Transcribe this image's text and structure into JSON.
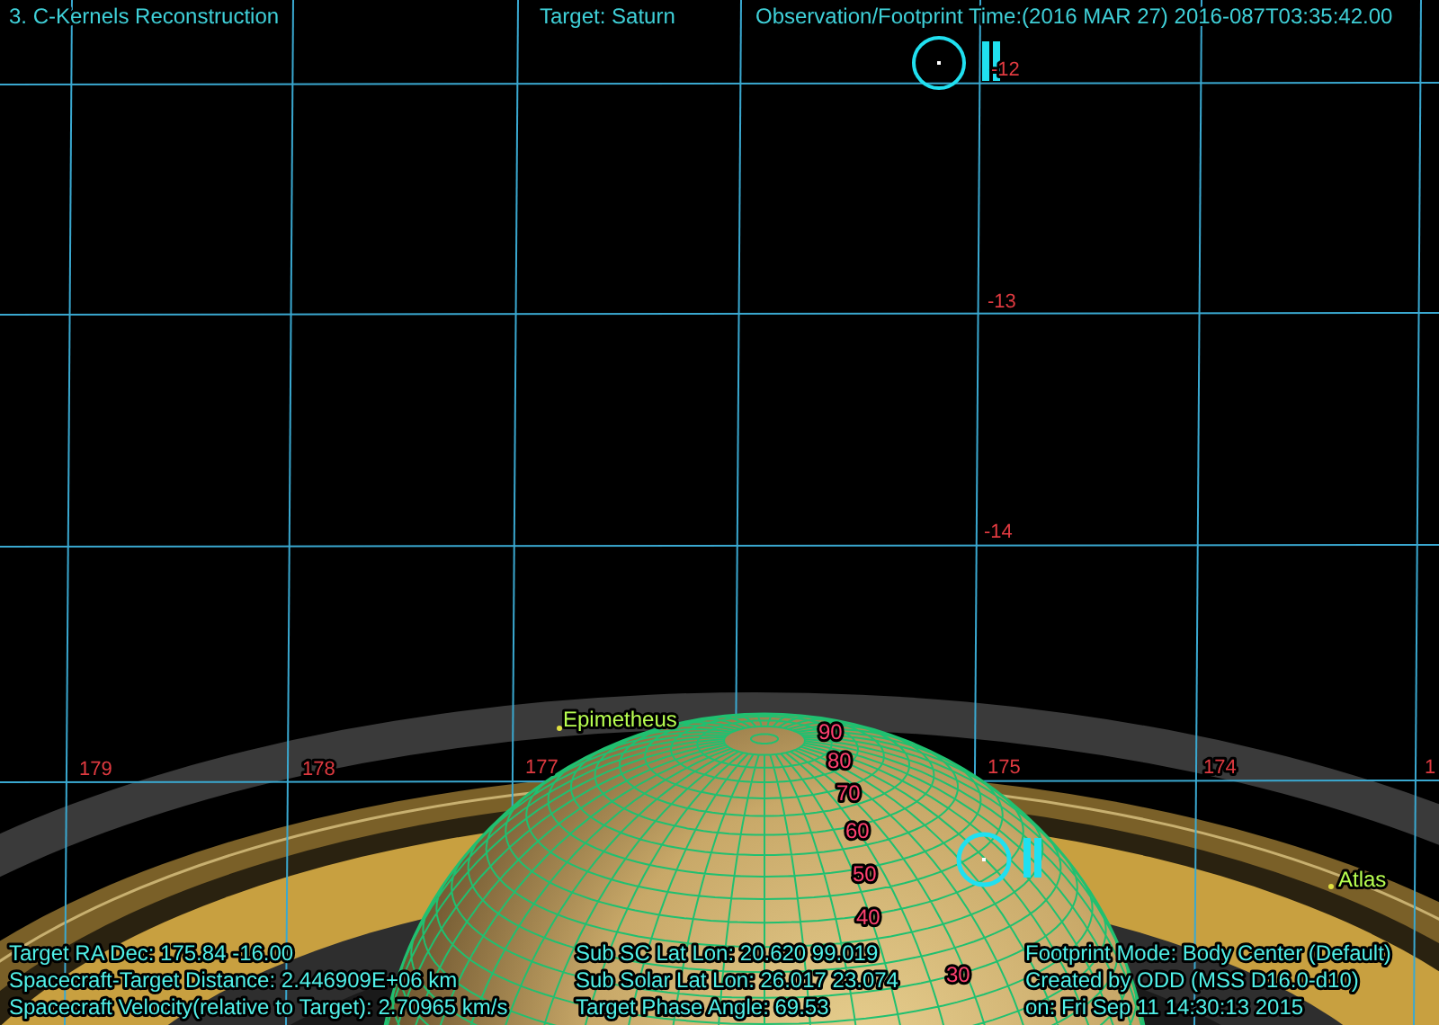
{
  "header": {
    "title": "3. C-Kernels Reconstruction",
    "target": "Target: Saturn",
    "time": "Observation/Footprint Time:(2016 MAR 27) 2016-087T03:35:42.00"
  },
  "ra_labels": [
    "179",
    "178",
    "177",
    "175",
    "174",
    "1"
  ],
  "dec_labels": [
    "-12",
    "-13",
    "-14"
  ],
  "latitude_labels": [
    "90",
    "80",
    "70",
    "60",
    "50",
    "40",
    "30"
  ],
  "moons": [
    "Epimetheus",
    "Atlas"
  ],
  "info_left": [
    "Target RA Dec: 175.84  -16.00",
    "Spacecraft-Target Distance: 2.446909E+06 km",
    "Spacecraft Velocity(relative to Target): 2.70965 km/s"
  ],
  "info_middle": [
    "Sub SC Lat Lon: 20.620  99.019",
    "Sub Solar Lat Lon: 26.017  23.074",
    "Target Phase Angle: 69.53"
  ],
  "info_right": [
    "Footprint Mode: Body Center (Default)",
    "Created by ODD (MSS D16.0-d10)",
    "on: Fri Sep 11 14:30:13 2015"
  ]
}
